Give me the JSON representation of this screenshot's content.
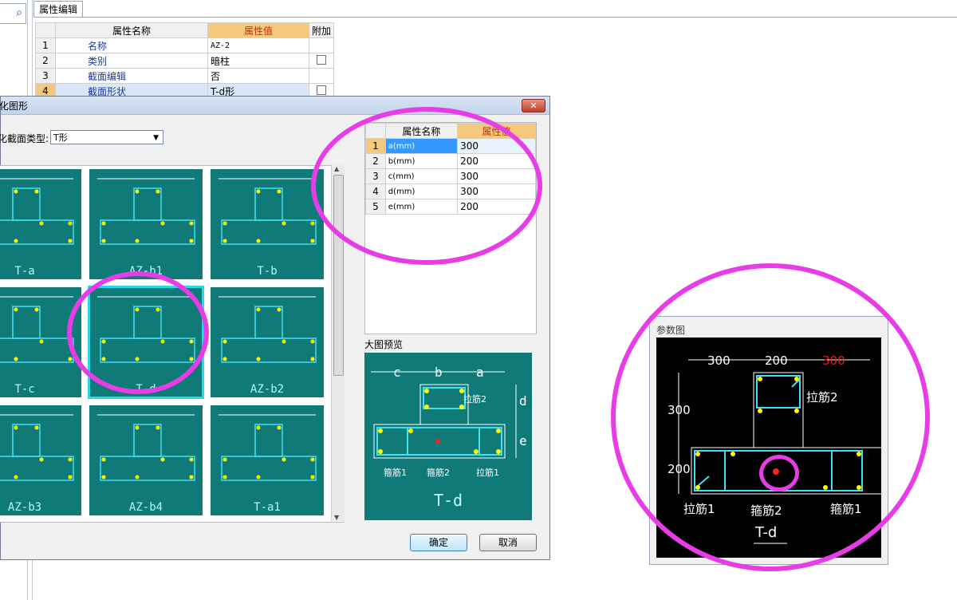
{
  "prop_panel": {
    "tab_label": "属性编辑",
    "headers": [
      "属性名称",
      "属性值",
      "附加"
    ],
    "rows": [
      {
        "num": "1",
        "name": "名称",
        "value": "AZ-2",
        "extra": ""
      },
      {
        "num": "2",
        "name": "类别",
        "value": "暗柱",
        "extra": "checkbox"
      },
      {
        "num": "3",
        "name": "截面编辑",
        "value": "否",
        "extra": ""
      },
      {
        "num": "4",
        "name": "截面形状",
        "value": "T-d形",
        "extra": "checkbox"
      }
    ]
  },
  "dialog": {
    "title": "化图形",
    "section_type_label": "化截面类型:",
    "section_type_value": "T形",
    "thumbnails": [
      "T-a",
      "AZ-b1",
      "T-b",
      "T-c",
      "T-d",
      "AZ-b2",
      "AZ-b3",
      "AZ-b4",
      "T-a1"
    ],
    "selected_thumbnail": "T-d",
    "param_headers": [
      "属性名称",
      "属性值"
    ],
    "params": [
      {
        "num": "1",
        "name": "a(mm)",
        "value": "300"
      },
      {
        "num": "2",
        "name": "b(mm)",
        "value": "200"
      },
      {
        "num": "3",
        "name": "c(mm)",
        "value": "300"
      },
      {
        "num": "4",
        "name": "d(mm)",
        "value": "300"
      },
      {
        "num": "5",
        "name": "e(mm)",
        "value": "200"
      }
    ],
    "preview_label": "大图预览",
    "preview_labels": {
      "c": "c",
      "b": "b",
      "a": "a",
      "d": "d",
      "e": "e",
      "lajin2": "拉筋2",
      "gujin1": "箍筋1",
      "gujin2": "箍筋2",
      "lajin1": "拉筋1"
    },
    "preview_caption": "T-d",
    "ok_label": "确定",
    "cancel_label": "取消"
  },
  "param_figure": {
    "title": "参数图",
    "dims_top": [
      "300",
      "200",
      "300"
    ],
    "dims_left": [
      "300",
      "200"
    ],
    "labels": {
      "lajin2": "拉筋2",
      "lajin1": "拉筋1",
      "gujin2": "箍筋2",
      "gujin1": "箍筋1"
    },
    "caption": "T-d"
  },
  "colors": {
    "highlight_ellipse": "#e83ce8",
    "thumb_bg": "#0f7a78",
    "rebar_yellow": "#ffff00",
    "highlight_red_dim": "#e82020"
  }
}
